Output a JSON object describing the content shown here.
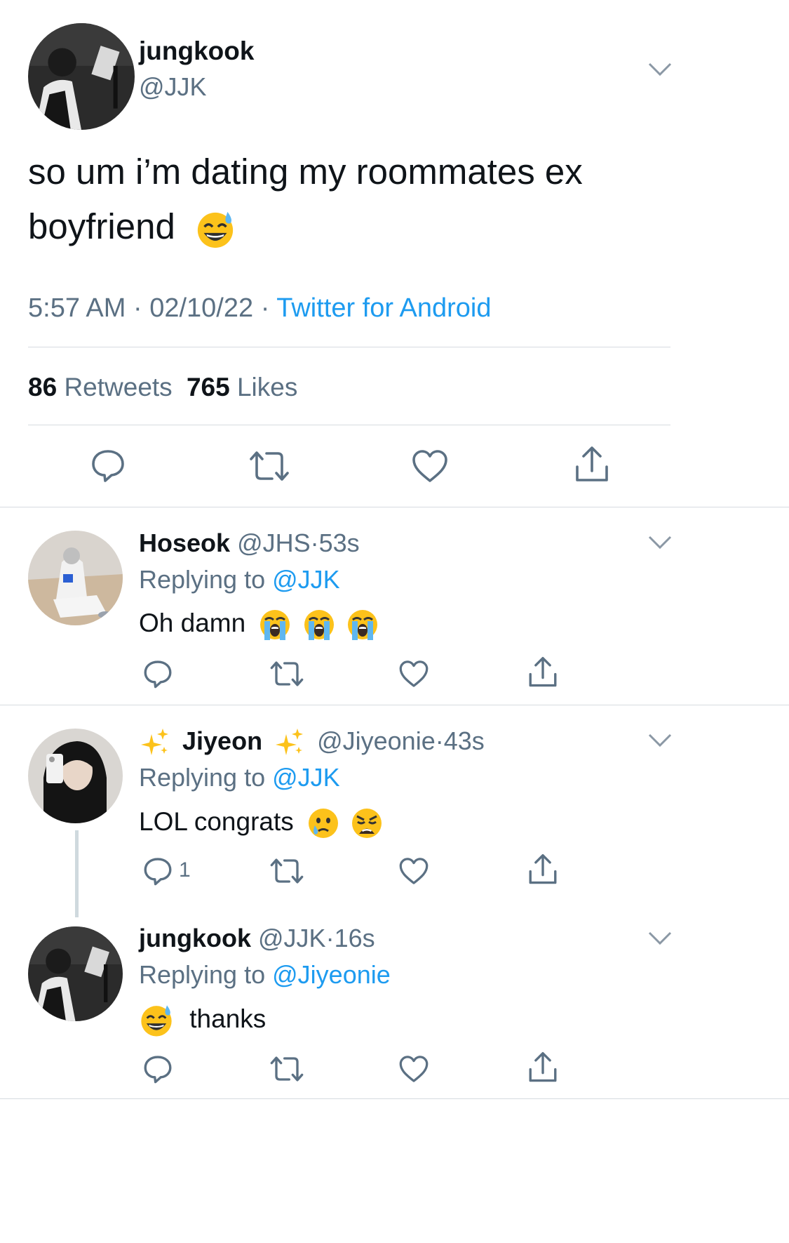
{
  "main_tweet": {
    "author": {
      "name": "jungkook",
      "handle": "@JJK"
    },
    "text": "so um i’m dating my roommates ex",
    "text_line2": "boyfriend",
    "emoji": "sweat-smile-emoji",
    "time": "5:57 AM",
    "date": "02/10/22",
    "source": "Twitter for Android",
    "sep": "·",
    "retweets_count": "86",
    "retweets_label": "Retweets",
    "likes_count": "765",
    "likes_label": "Likes"
  },
  "replies": [
    {
      "name": "Hoseok",
      "handle": "@JHS",
      "time": "53s",
      "replying_prefix": "Replying to",
      "replying_to": "@JJK",
      "text": "Oh damn",
      "emojis": [
        "loudly-crying-emoji",
        "loudly-crying-emoji",
        "loudly-crying-emoji"
      ],
      "reply_count": ""
    },
    {
      "name": "Jiyeon",
      "name_decoration": "sparkles-emoji",
      "handle": "@Jiyeonie",
      "time": "43s",
      "replying_prefix": "Replying to",
      "replying_to": "@JJK",
      "text": "LOL congrats",
      "emojis": [
        "crying-face-emoji",
        "weary-face-emoji"
      ],
      "reply_count": "1"
    },
    {
      "name": "jungkook",
      "handle": "@JJK",
      "time": "16s",
      "replying_prefix": "Replying to",
      "replying_to": "@Jiyeonie",
      "text": "thanks",
      "emojis": [
        "sweat-smile-emoji"
      ],
      "reply_count": ""
    }
  ],
  "colors": {
    "accent": "#1d9bf0",
    "secondary_text": "#5b7083",
    "divider": "#d6dbe0"
  },
  "icons": {
    "reply": "reply-icon",
    "retweet": "retweet-icon",
    "like": "heart-icon",
    "share": "share-icon",
    "more": "chevron-down-icon"
  }
}
